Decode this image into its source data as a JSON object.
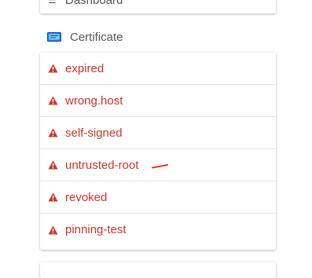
{
  "top_section": {
    "item_label": "Dashboard",
    "icon": "list-icon"
  },
  "certificate_section": {
    "title": "Certificate",
    "icon": "certificate-card-icon",
    "icon_color": "#1e88e5",
    "items": [
      {
        "label": "expired",
        "icon": "warning-icon"
      },
      {
        "label": "wrong.host",
        "icon": "warning-icon"
      },
      {
        "label": "self-signed",
        "icon": "warning-icon"
      },
      {
        "label": "untrusted-root",
        "icon": "warning-icon"
      },
      {
        "label": "revoked",
        "icon": "warning-icon"
      },
      {
        "label": "pinning-test",
        "icon": "warning-icon"
      }
    ]
  },
  "colors": {
    "warning": "#c0392b",
    "annotation": "#e53935",
    "text": "#555555"
  }
}
